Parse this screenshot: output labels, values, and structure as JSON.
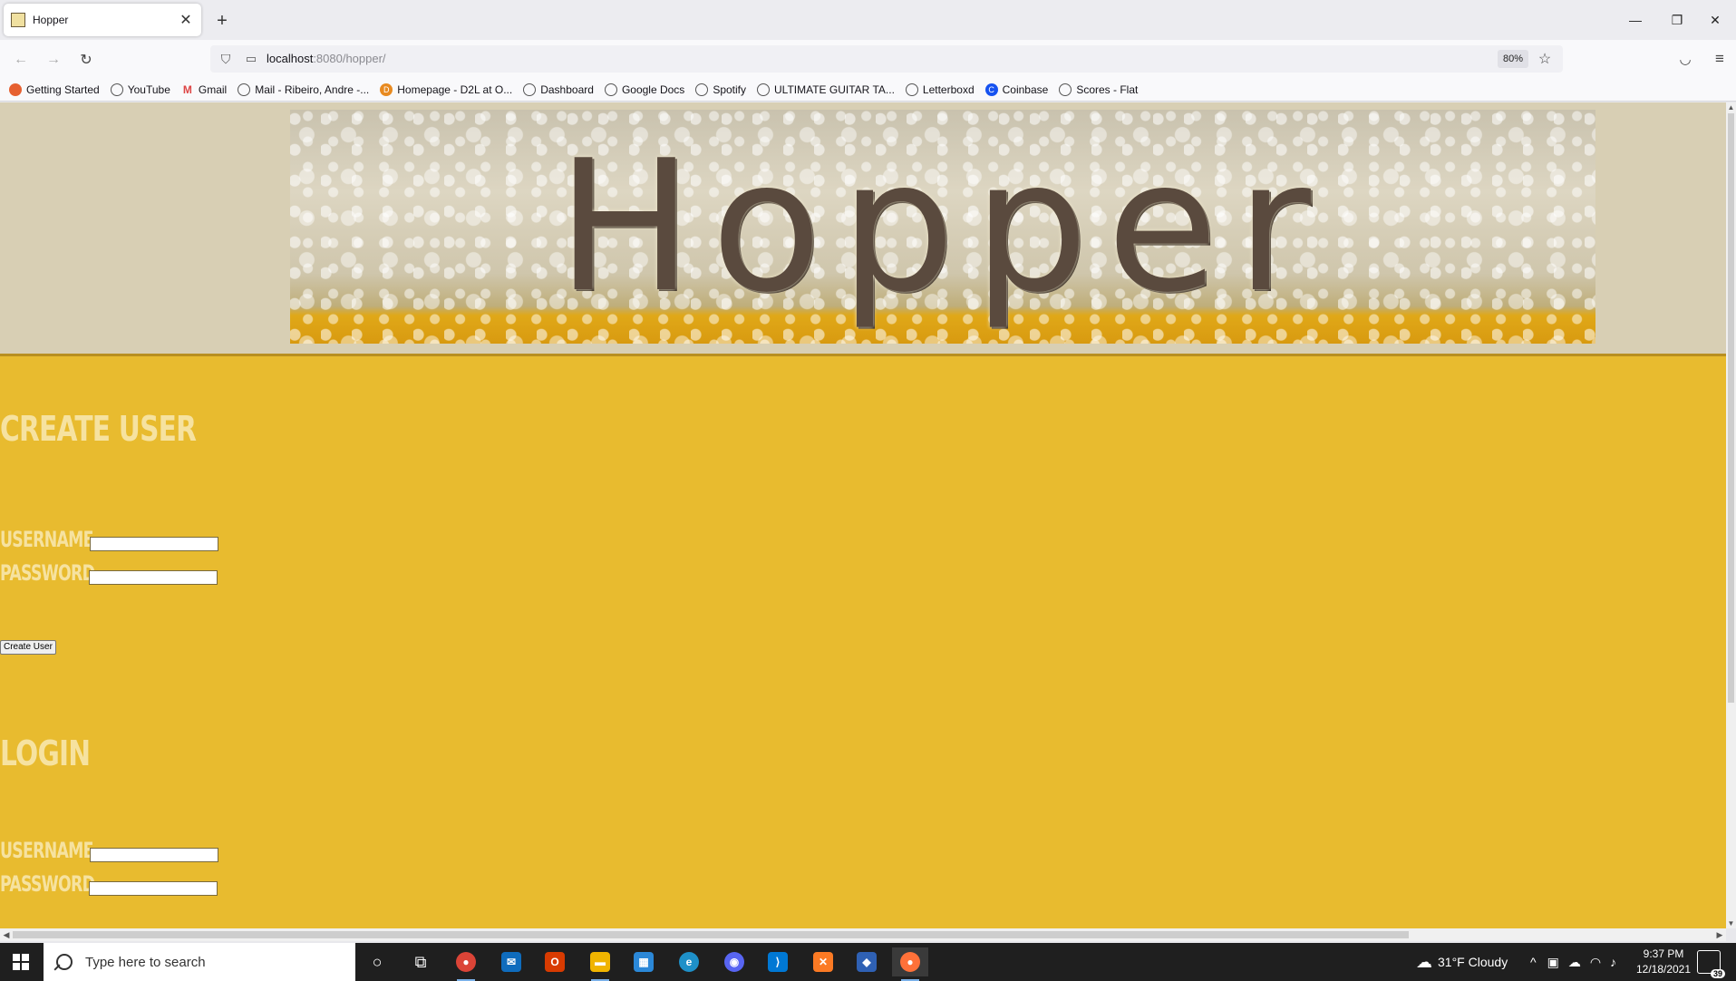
{
  "browser": {
    "tab": {
      "title": "Hopper"
    },
    "url": {
      "host": "localhost",
      "rest": ":8080/hopper/"
    },
    "zoom": "80%",
    "bookmarks": [
      {
        "label": "Getting Started",
        "icon": "firefox-icon"
      },
      {
        "label": "YouTube",
        "icon": "globe-icon"
      },
      {
        "label": "Gmail",
        "icon": "gmail-icon"
      },
      {
        "label": "Mail - Ribeiro, Andre -...",
        "icon": "globe-icon"
      },
      {
        "label": "Homepage - D2L at O...",
        "icon": "d2l-icon"
      },
      {
        "label": "Dashboard",
        "icon": "globe-icon"
      },
      {
        "label": "Google Docs",
        "icon": "globe-icon"
      },
      {
        "label": "Spotify",
        "icon": "globe-icon"
      },
      {
        "label": "ULTIMATE GUITAR TA...",
        "icon": "globe-icon"
      },
      {
        "label": "Letterboxd",
        "icon": "globe-icon"
      },
      {
        "label": "Coinbase",
        "icon": "coinbase-icon"
      },
      {
        "label": "Scores - Flat",
        "icon": "globe-icon"
      }
    ]
  },
  "page": {
    "banner_title": "Hopper",
    "create_user": {
      "heading": "CREATE USER",
      "username_label": "USERNAME",
      "password_label": "PASSWORD",
      "username_value": "",
      "password_value": "",
      "button_label": "Create User"
    },
    "login": {
      "heading": "LOGIN",
      "username_label": "USERNAME",
      "password_label": "PASSWORD",
      "username_value": "",
      "password_value": ""
    }
  },
  "taskbar": {
    "search_placeholder": "Type here to search",
    "weather": "31°F  Cloudy",
    "time": "9:37 PM",
    "date": "12/18/2021",
    "notifications": "39"
  },
  "colors": {
    "page_header_bg": "#d8cfb4",
    "page_main_bg": "#e8bb2f",
    "heading_text": "#f6e2a0"
  }
}
